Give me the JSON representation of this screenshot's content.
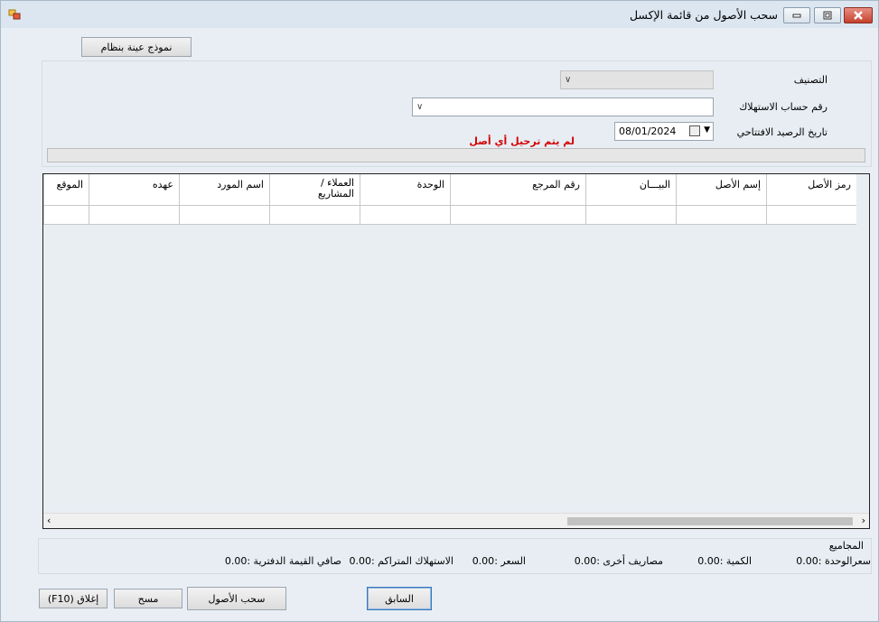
{
  "window": {
    "title": "سحب الأصول من قائمة الإكسل",
    "icon": "app-window-icon",
    "controls": [
      "minimize-icon",
      "restore-icon",
      "close-icon"
    ]
  },
  "toolbar": {
    "sample_button": "نموذج عينة بنظام"
  },
  "form": {
    "category_label": "التصنيف",
    "category_value": "",
    "depreciation_account_label": "رقم حساب الاستهلاك",
    "depreciation_account_value": "",
    "opening_balance_date_label": "تاريخ الرصيد الافتتاحي",
    "opening_balance_date_value": "08/01/2024",
    "status_message": "لم يتم ترحيل أي أصل",
    "status_color": "#d50000"
  },
  "grid": {
    "columns": [
      "رمز الأصل",
      "إسم الأصل",
      "البيـــان",
      "رقم المرجع",
      "الوحدة",
      "العملاء / المشاريع",
      "اسم المورد",
      "عهده",
      "الموقع"
    ],
    "rows": [
      [
        "",
        "",
        "",
        "",
        "",
        "",
        "",
        "",
        ""
      ]
    ]
  },
  "totals": {
    "title": "المجاميع",
    "unit_price": "سعرالوحدة :0.00",
    "quantity": "الكمية :0.00",
    "other_expenses": "مصاريف أخرى :0.00",
    "price": "السعر :0.00",
    "accumulated_depreciation": "الاستهلاك المتراكم :0.00",
    "net_book_value": "صافي القيمة الدفترية :0.00"
  },
  "footer": {
    "previous_button": "السابق",
    "pull_assets_button": "سحب الأصول",
    "clear_button": "مسح",
    "close_button": "إغلاق (F10)"
  }
}
